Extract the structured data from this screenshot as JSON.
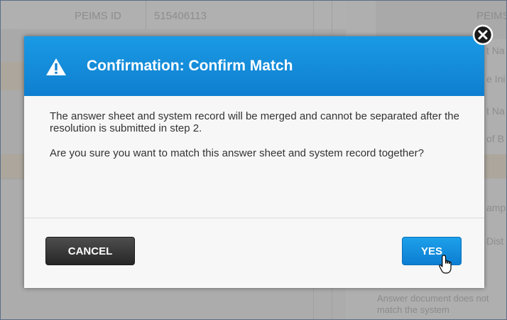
{
  "background": {
    "peims_label": "PEIMS ID",
    "peims_value": "515406113",
    "right_header": "PEIMS",
    "right_rows": [
      "t Na",
      "e Ini",
      "t Na",
      "of B"
    ],
    "right_rows_lower": [
      "amp",
      "Dist"
    ],
    "footer_note": "Answer document does not match the system"
  },
  "dialog": {
    "title": "Confirmation: Confirm Match",
    "paragraph1": "The answer sheet and system record will be merged and cannot be separated after the resolution is submitted in step 2.",
    "paragraph2": "Are you sure you want to match this answer sheet and system record together?",
    "cancel_label": "CANCEL",
    "yes_label": "YES"
  },
  "colors": {
    "header_blue": "#1589db",
    "yes_blue": "#1592e0",
    "cancel_dark": "#333333"
  },
  "icons": [
    "warning-icon",
    "close-icon",
    "hand-cursor-icon"
  ]
}
